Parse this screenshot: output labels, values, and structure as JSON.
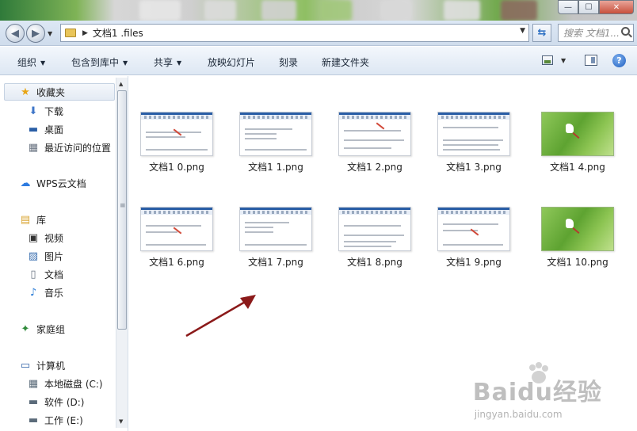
{
  "window": {
    "controls": {
      "minimize": "—",
      "maximize": "☐",
      "close": "✕"
    }
  },
  "address_bar": {
    "path": "文档1 .files",
    "search_placeholder": "搜索 文档1..."
  },
  "toolbar": {
    "items": [
      "组织",
      "包含到库中",
      "共享",
      "放映幻灯片",
      "刻录",
      "新建文件夹"
    ],
    "help": "?"
  },
  "nav_pane": {
    "favorites_header": "收藏夹",
    "favorites": [
      "下载",
      "桌面",
      "最近访问的位置"
    ],
    "wps": "WPS云文档",
    "libraries_header": "库",
    "libraries": [
      "视频",
      "图片",
      "文档",
      "音乐"
    ],
    "homegroup": "家庭组",
    "computer_header": "计算机",
    "drives": [
      "本地磁盘 (C:)",
      "软件 (D:)",
      "工作 (E:)"
    ]
  },
  "files": [
    {
      "name": "文档1 0.png",
      "thumb": "doc"
    },
    {
      "name": "文档1 1.png",
      "thumb": "doc"
    },
    {
      "name": "文档1 2.png",
      "thumb": "doc"
    },
    {
      "name": "文档1 3.png",
      "thumb": "doc"
    },
    {
      "name": "文档1 4.png",
      "thumb": "green"
    },
    {
      "name": "文档1 6.png",
      "thumb": "doc"
    },
    {
      "name": "文档1 7.png",
      "thumb": "doc"
    },
    {
      "name": "文档1 8.png",
      "thumb": "doc"
    },
    {
      "name": "文档1 9.png",
      "thumb": "doc"
    },
    {
      "name": "文档1 10.png",
      "thumb": "green"
    }
  ],
  "watermark": {
    "brand": "Baidu经验",
    "url": "jingyan.baidu.com"
  },
  "colors": {
    "arrow": "#8b1a1a",
    "ribbon": "#2a5ea6",
    "accent_blue": "#1f5ebf"
  }
}
